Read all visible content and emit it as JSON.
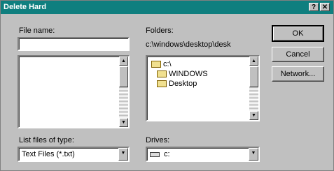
{
  "dialog": {
    "title": "Delete Hard",
    "help_glyph": "?",
    "close_glyph": "✕"
  },
  "file_name": {
    "label": "File name:",
    "value": ""
  },
  "files_list": {
    "items": []
  },
  "folders": {
    "label": "Folders:",
    "path": "c:\\windows\\desktop\\desk",
    "tree": [
      {
        "label": "c:\\",
        "icon": "open-folder-icon"
      },
      {
        "label": "WINDOWS",
        "icon": "open-folder-icon"
      },
      {
        "label": "Desktop",
        "icon": "open-folder-icon"
      }
    ]
  },
  "file_type": {
    "label": "List files of type:",
    "selected": "Text Files (*.txt)"
  },
  "drives": {
    "label": "Drives:",
    "selected": "c: "
  },
  "buttons": {
    "ok": "OK",
    "cancel": "Cancel",
    "network": "Network..."
  },
  "colors": {
    "titlebar": "#0f7f7f",
    "face": "#c0c0c0"
  }
}
